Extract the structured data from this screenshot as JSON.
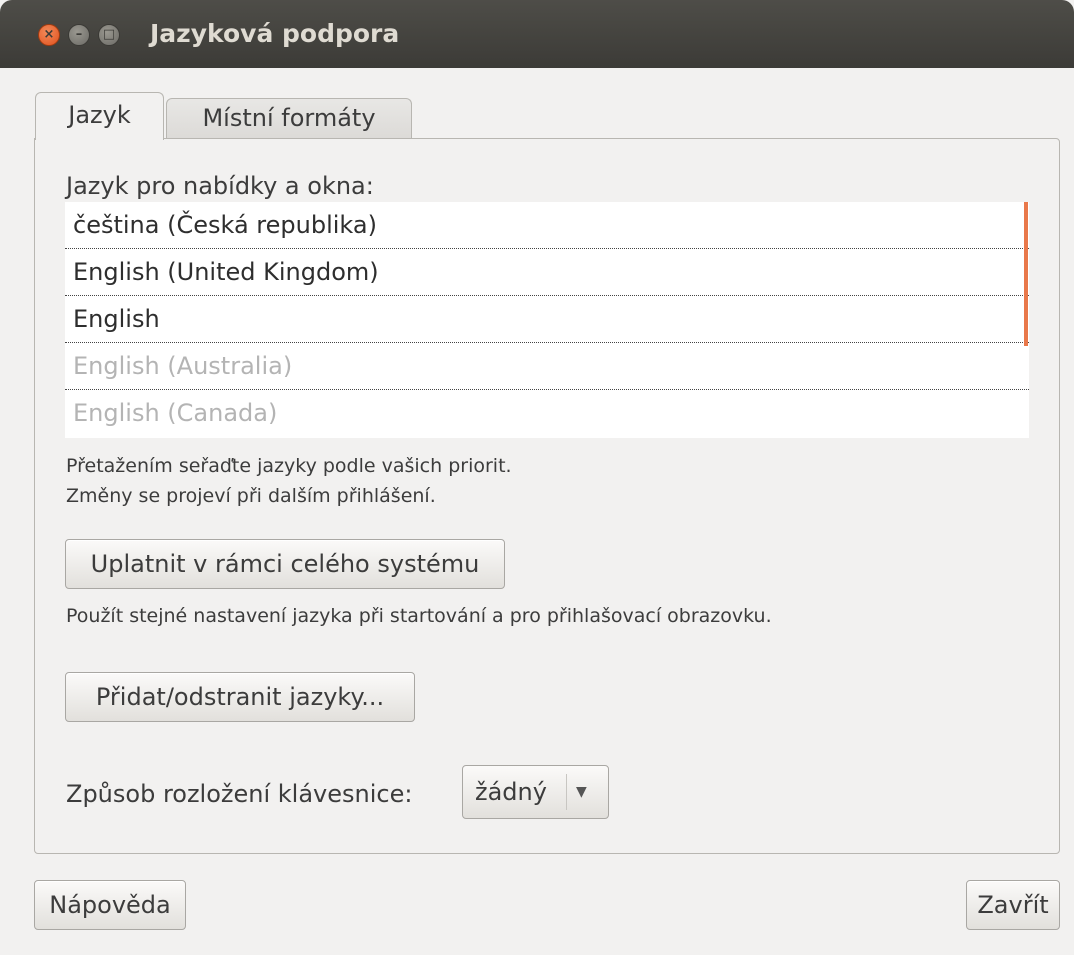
{
  "window": {
    "title": "Jazyková podpora"
  },
  "tabs": [
    {
      "label": "Jazyk",
      "active": true
    },
    {
      "label": "Místní formáty",
      "active": false
    }
  ],
  "language": {
    "section_label": "Jazyk pro nabídky a okna:",
    "items": [
      {
        "label": "čeština (Česká republika)",
        "enabled": true
      },
      {
        "label": "English (United Kingdom)",
        "enabled": true
      },
      {
        "label": "English",
        "enabled": true
      },
      {
        "label": "English (Australia)",
        "enabled": false
      },
      {
        "label": "English (Canada)",
        "enabled": false
      }
    ],
    "hint_line1": "Přetažením seřaďte jazyky podle vašich priorit.",
    "hint_line2": "Změny se projeví při dalším přihlášení.",
    "apply_button": "Uplatnit v rámci celého systému",
    "apply_hint": "Použít stejné nastavení jazyka při startování a pro přihlašovací obrazovku.",
    "add_remove_button": "Přidat/odstranit jazyky...",
    "keyboard_label": "Způsob rozložení klávesnice:",
    "keyboard_value": "žádný"
  },
  "footer": {
    "help_button": "Nápověda",
    "close_button": "Zavřít"
  },
  "colors": {
    "titlebar": "#3c3b37",
    "accent": "#e9784a",
    "background": "#f2f1f0"
  }
}
